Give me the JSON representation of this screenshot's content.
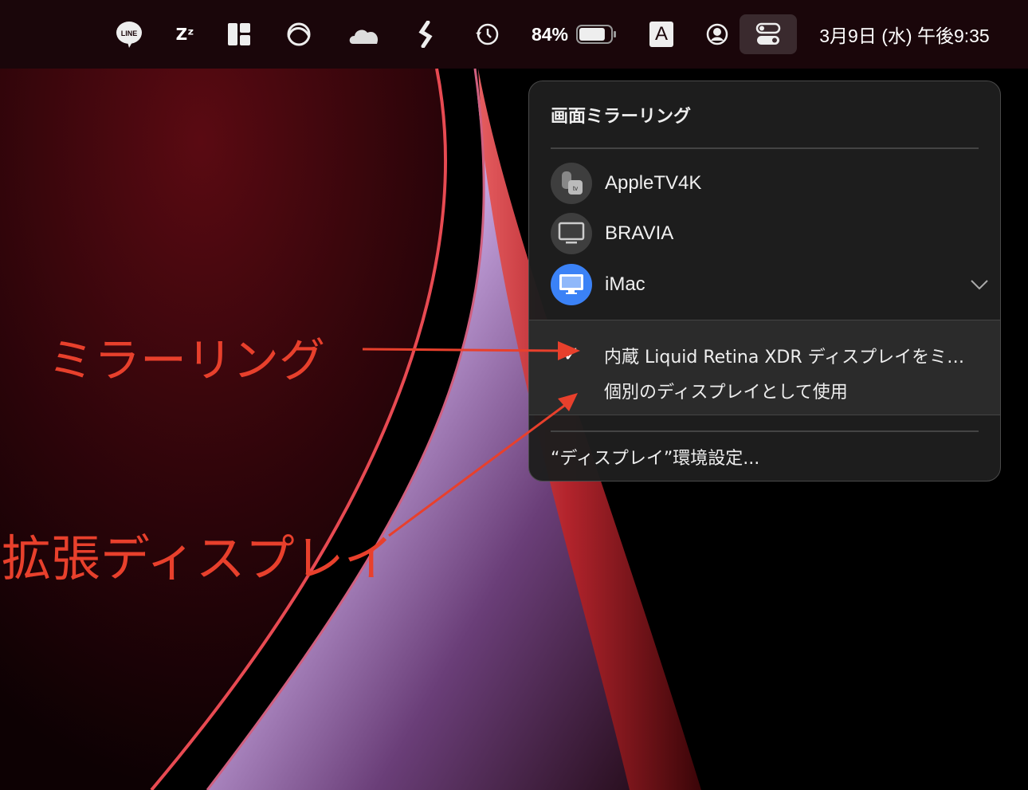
{
  "menubar": {
    "icons": [
      "line-icon",
      "sleep-icon",
      "layout-icon",
      "creative-cloud-icon",
      "cloud-icon",
      "script-icon",
      "time-machine-icon",
      "battery-icon",
      "input-method-icon",
      "user-icon",
      "control-center-icon"
    ],
    "battery_percent": "84%",
    "battery_level": 84,
    "line_label": "LINE",
    "input_method_label": "A",
    "clock": "3月9日 (水) 午後9:35"
  },
  "panel": {
    "title": "画面ミラーリング",
    "devices": [
      {
        "label": "AppleTV4K",
        "icon": "apple-tv-icon",
        "tv_label": "tv"
      },
      {
        "label": "BRAVIA",
        "icon": "tv-display-icon"
      },
      {
        "label": "iMac",
        "icon": "imac-icon",
        "expanded": true
      }
    ],
    "options": [
      {
        "label": "内蔵 Liquid Retina XDR ディスプレイをミ…",
        "checked": true
      },
      {
        "label": "個別のディスプレイとして使用",
        "checked": false
      }
    ],
    "check_glyph": "✓",
    "preferences_label": "“ディスプレイ”環境設定..."
  },
  "annotations": {
    "mirroring": "ミラーリング",
    "extended": "拡張ディスプレイ",
    "color": "#e8402c"
  },
  "colors": {
    "accent": "#3b82f6",
    "menubar": "#1a060a"
  }
}
